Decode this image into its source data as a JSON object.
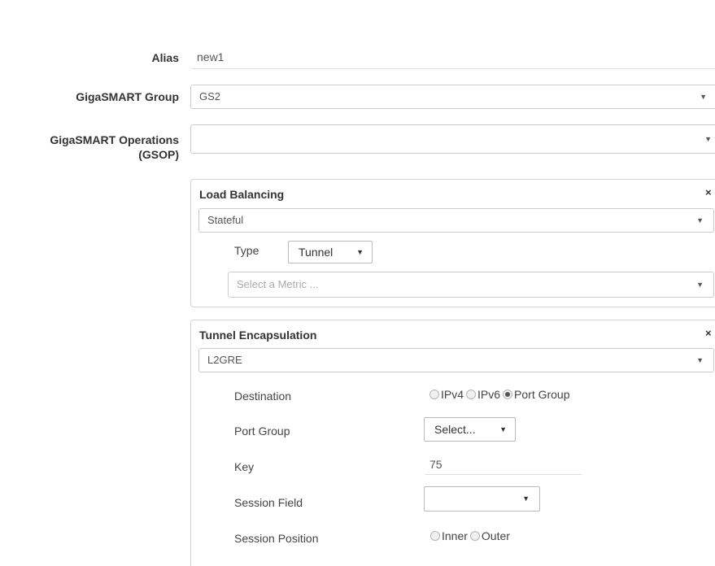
{
  "form": {
    "alias": {
      "label": "Alias",
      "value": "new1"
    },
    "gigasmart_group": {
      "label": "GigaSMART Group",
      "value": "GS2"
    },
    "gigasmart_operations": {
      "label_line1": "GigaSMART Operations",
      "label_line2": "(GSOP)",
      "value": ""
    }
  },
  "load_balancing": {
    "title": "Load Balancing",
    "close": "×",
    "mode": "Stateful",
    "type_label": "Type",
    "type_value": "Tunnel",
    "metric_placeholder": "Select a Metric ..."
  },
  "tunnel_encapsulation": {
    "title": "Tunnel Encapsulation",
    "close": "×",
    "protocol": "L2GRE",
    "destination": {
      "label": "Destination",
      "options": [
        "IPv4",
        "IPv6",
        "Port Group"
      ],
      "selected": "Port Group"
    },
    "port_group": {
      "label": "Port Group",
      "value": "Select..."
    },
    "key": {
      "label": "Key",
      "value": "75"
    },
    "session_field": {
      "label": "Session Field",
      "value": ""
    },
    "session_position": {
      "label": "Session Position",
      "options": [
        "Inner",
        "Outer"
      ],
      "selected": ""
    }
  },
  "icons": {
    "caret": "▼"
  }
}
